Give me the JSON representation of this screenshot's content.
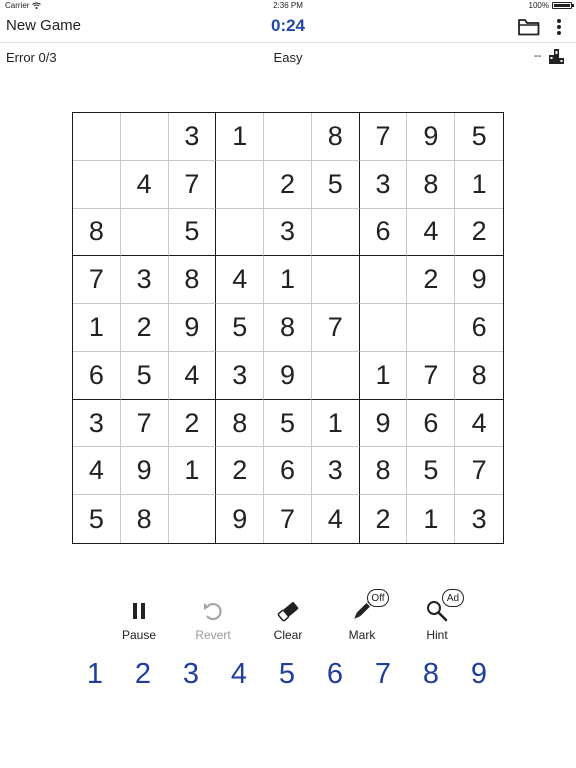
{
  "status_bar": {
    "carrier": "Carrier",
    "time": "2:36 PM",
    "battery": "100%"
  },
  "header": {
    "new_game_label": "New Game",
    "timer": "0:24"
  },
  "info": {
    "error_text": "Error 0/3",
    "difficulty": "Easy",
    "rank_text": "--"
  },
  "board": {
    "rows": [
      [
        "",
        "",
        "3",
        "1",
        "",
        "8",
        "7",
        "9",
        "5"
      ],
      [
        "",
        "4",
        "7",
        "",
        "2",
        "5",
        "3",
        "8",
        "1"
      ],
      [
        "8",
        "",
        "5",
        "",
        "3",
        "",
        "6",
        "4",
        "2"
      ],
      [
        "7",
        "3",
        "8",
        "4",
        "1",
        "",
        "",
        "2",
        "9"
      ],
      [
        "1",
        "2",
        "9",
        "5",
        "8",
        "7",
        "",
        "",
        "6"
      ],
      [
        "6",
        "5",
        "4",
        "3",
        "9",
        "",
        "1",
        "7",
        "8"
      ],
      [
        "3",
        "7",
        "2",
        "8",
        "5",
        "1",
        "9",
        "6",
        "4"
      ],
      [
        "4",
        "9",
        "1",
        "2",
        "6",
        "3",
        "8",
        "5",
        "7"
      ],
      [
        "5",
        "8",
        "",
        "9",
        "7",
        "4",
        "2",
        "1",
        "3"
      ]
    ]
  },
  "toolbar": {
    "pause": {
      "label": "Pause",
      "icon": "pause-icon"
    },
    "revert": {
      "label": "Revert",
      "icon": "undo-icon",
      "disabled": true
    },
    "clear": {
      "label": "Clear",
      "icon": "eraser-icon"
    },
    "mark": {
      "label": "Mark",
      "icon": "pencil-icon",
      "badge": "Off"
    },
    "hint": {
      "label": "Hint",
      "icon": "magnifier-icon",
      "badge": "Ad"
    }
  },
  "numpad": [
    "1",
    "2",
    "3",
    "4",
    "5",
    "6",
    "7",
    "8",
    "9"
  ],
  "colors": {
    "accent": "#2347a8",
    "numpad": "#1f3e9e",
    "disabled": "#9a9a9a",
    "grid_thick": "#1a1a1a",
    "grid_thin": "#c8c8c8"
  }
}
